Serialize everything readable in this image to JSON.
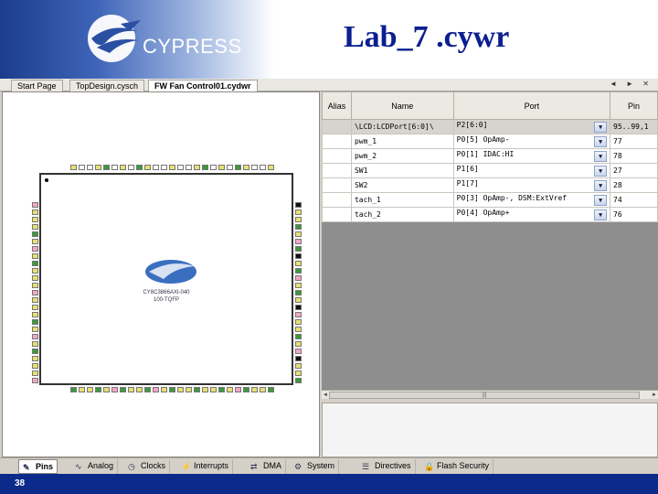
{
  "header": {
    "logo_text": "CYPRESS",
    "title": "Lab_7 .cywr"
  },
  "editor_tabs": [
    {
      "label": "Start Page",
      "active": false
    },
    {
      "label": "TopDesign.cysch",
      "active": false
    },
    {
      "label": "FW Fan Control01.cydwr",
      "active": true
    }
  ],
  "window_controls": "◄ ► ✕",
  "chip": {
    "part_number": "CY8C3866AXI-040",
    "package": "100-TQFP"
  },
  "grid": {
    "columns": [
      "Alias",
      "Name",
      "Port",
      "Pin"
    ],
    "rows": [
      {
        "alias": "",
        "name": "\\LCD:LCDPort[6:0]\\",
        "port": "P2[6:0]",
        "pin": "95..99,1",
        "selected": true
      },
      {
        "alias": "",
        "name": "pwm_1",
        "port": "P0[5] OpAmp-",
        "pin": "77"
      },
      {
        "alias": "",
        "name": "pwm_2",
        "port": "P0[1] IDAC:HI",
        "pin": "78"
      },
      {
        "alias": "",
        "name": "SW1",
        "port": "P1[6]",
        "pin": "27"
      },
      {
        "alias": "",
        "name": "SW2",
        "port": "P1[7]",
        "pin": "28"
      },
      {
        "alias": "",
        "name": "tach_1",
        "port": "P0[3] OpAmp-, DSM:ExtVref",
        "pin": "74"
      },
      {
        "alias": "",
        "name": "tach_2",
        "port": "P0[4] OpAmp+",
        "pin": "76"
      }
    ]
  },
  "bottom_tabs": [
    {
      "label": "Pins",
      "icon": "pins-icon",
      "active": true
    },
    {
      "label": "Analog",
      "icon": "analog-icon"
    },
    {
      "label": "Clocks",
      "icon": "clock-icon"
    },
    {
      "label": "Interrupts",
      "icon": "interrupts-icon"
    },
    {
      "label": "DMA",
      "icon": "dma-icon"
    },
    {
      "label": "System",
      "icon": "system-icon"
    },
    {
      "label": "Directives",
      "icon": "directives-icon"
    },
    {
      "label": "Flash Security",
      "icon": "flash-security-icon"
    }
  ],
  "footer": {
    "page_number": "38"
  },
  "colors": {
    "title": "#0b1f8f",
    "footer": "#0b2a8a",
    "pin_green": "#3a9a3a",
    "pin_yellow": "#e8e070",
    "pin_pink": "#f3a6c6",
    "pin_black": "#111111"
  }
}
